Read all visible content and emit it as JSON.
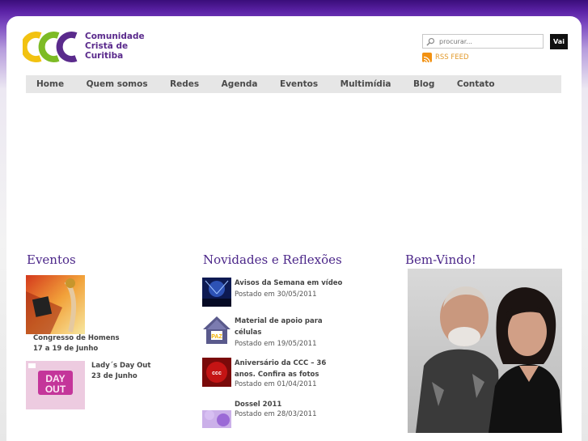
{
  "brand": {
    "name": "Comunidade Cristã de Curitiba",
    "name_lines": [
      "Comunidade",
      "Cristã de",
      "Curitiba"
    ],
    "colors": {
      "purple": "#5a2a8c",
      "yellow": "#f2c211",
      "green": "#7dbb25",
      "heading": "#4b2689"
    }
  },
  "search": {
    "placeholder": "procurar...",
    "button_label": "Vai"
  },
  "rss": {
    "label": "RSS FEED"
  },
  "nav": {
    "items": [
      "Home",
      "Quem somos",
      "Redes",
      "Agenda",
      "Eventos",
      "Multimídia",
      "Blog",
      "Contato"
    ]
  },
  "eventos": {
    "title": "Eventos",
    "items": [
      {
        "lines": [
          "Congresso de Homens",
          "17 a 19 de Junho"
        ],
        "thumb_icon": "congress-poster-image"
      },
      {
        "lines": [
          "Lady´s Day Out",
          "23 de Junho"
        ],
        "thumb_icon": "day-out-poster-image",
        "thumb_text": [
          "DAY",
          "OUT"
        ]
      }
    ]
  },
  "novidades": {
    "title": "Novidades e Reflexões",
    "items": [
      {
        "title": "Avisos da Semana em vídeo",
        "date": "Postado em 30/05/2011"
      },
      {
        "title": "Material de apoio para células",
        "date": "Postado em 19/05/2011",
        "thumb_text": "PAZ"
      },
      {
        "title": "Aniversário da CCC – 36 anos. Confira as fotos",
        "date": "Postado em 01/04/2011"
      },
      {
        "title": "Dossel 2011",
        "date": "Postado em 28/03/2011"
      }
    ]
  },
  "bemvindo": {
    "title": "Bem-Vindo!",
    "photo_icon": "pastors-couple-photo"
  }
}
